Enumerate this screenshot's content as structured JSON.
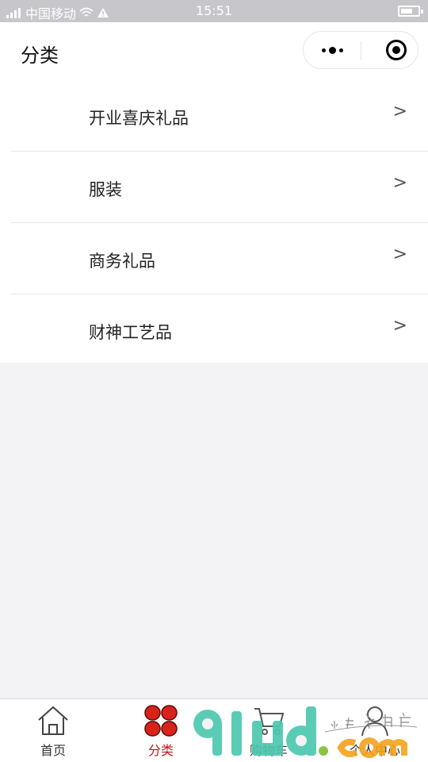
{
  "status_bar": {
    "carrier": "中国移动",
    "time": "15:51"
  },
  "nav": {
    "title": "分类"
  },
  "categories": [
    {
      "label": "开业喜庆礼品",
      "chevron": ">"
    },
    {
      "label": "服装",
      "chevron": ">"
    },
    {
      "label": "商务礼品",
      "chevron": ">"
    },
    {
      "label": "财神工艺品",
      "chevron": ">"
    }
  ],
  "tabs": [
    {
      "label": "首页",
      "icon": "home-icon",
      "active": false
    },
    {
      "label": "分类",
      "icon": "category-icon",
      "active": true
    },
    {
      "label": "购物车",
      "icon": "cart-icon",
      "active": false
    },
    {
      "label": "个人中心",
      "icon": "profile-icon",
      "active": false
    }
  ],
  "colors": {
    "active_tab": "#c3161c",
    "status_bar": "#c7c6cb",
    "page_background": "#f3f2f4"
  },
  "watermark": {
    "logo_text": "91ud.com",
    "handwritten": "小程序商店"
  }
}
